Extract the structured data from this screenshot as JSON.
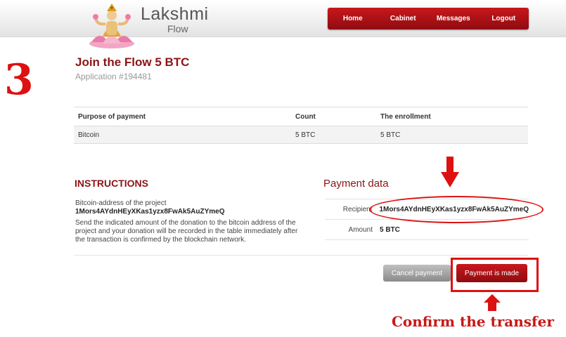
{
  "brand": {
    "name": "Lakshmi",
    "sub": "Flow"
  },
  "nav": [
    {
      "label": "Home"
    },
    {
      "label": "Cabinet"
    },
    {
      "label": "Messages"
    },
    {
      "label": "Logout"
    }
  ],
  "step_number": "3",
  "page": {
    "title": "Join the Flow 5 BTC",
    "application": "Application #194481"
  },
  "payment_table": {
    "headers": [
      "Purpose of payment",
      "Count",
      "The enrollment"
    ],
    "rows": [
      {
        "purpose": "Bitcoin",
        "count": "5 BTC",
        "enrollment": "5 BTC"
      }
    ]
  },
  "instructions": {
    "title": "INSTRUCTIONS",
    "address_label": "Bitcoin-address of the project",
    "address": "1Mors4AYdnHEyXKas1yzx8FwAk5AuZYmeQ",
    "text": "Send the indicated amount of the donation to the bitcoin address of the project and your donation will be recorded in the table immediately after the transaction is confirmed by the blockchain network."
  },
  "payment_data": {
    "title": "Payment data",
    "recipient_label": "Recipient",
    "recipient": "1Mors4AYdnHEyXKas1yzx8FwAk5AuZYmeQ",
    "amount_label": "Amount",
    "amount": "5 BTC"
  },
  "buttons": {
    "cancel": "Cancel payment",
    "made": "Payment is made"
  },
  "annotation": {
    "confirm": "Confirm the transfer"
  },
  "colors": {
    "brand_red": "#8b1414",
    "nav_red": "#b3131a",
    "annotation_red": "#d11111"
  }
}
